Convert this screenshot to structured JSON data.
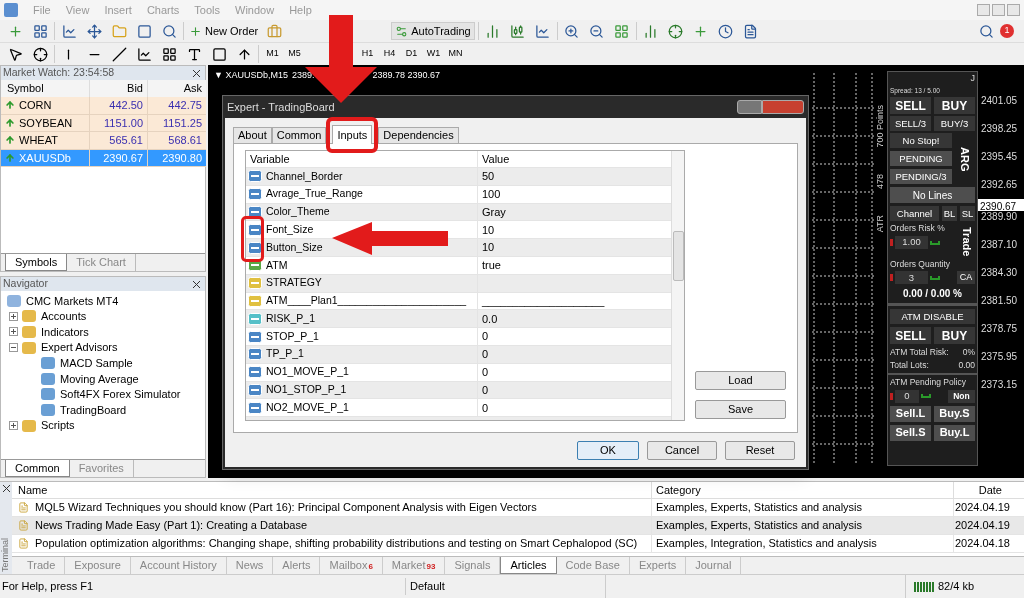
{
  "menu": [
    "File",
    "View",
    "Insert",
    "Charts",
    "Tools",
    "Window",
    "Help"
  ],
  "notifications": "1",
  "toolbar_buttons": [
    "New Order",
    "AutoTrading"
  ],
  "timeframes": [
    {
      "label": "M1",
      "selected": false
    },
    {
      "label": "M5",
      "selected": false
    },
    {
      "label": "H1",
      "selected": false
    },
    {
      "label": "H4",
      "selected": false
    },
    {
      "label": "D1",
      "selected": false
    },
    {
      "label": "W1",
      "selected": false
    },
    {
      "label": "MN",
      "selected": false
    }
  ],
  "market_watch": {
    "title": "Market Watch: 23:54:58",
    "columns": [
      "Symbol",
      "Bid",
      "Ask"
    ],
    "rows": [
      {
        "symbol": "CORN",
        "bid": "442.50",
        "ask": "442.75",
        "selected": false
      },
      {
        "symbol": "SOYBEAN",
        "bid": "1151.00",
        "ask": "1151.25",
        "selected": false
      },
      {
        "symbol": "WHEAT",
        "bid": "565.61",
        "ask": "568.61",
        "selected": false
      },
      {
        "symbol": "XAUUSDb",
        "bid": "2390.67",
        "ask": "2390.80",
        "selected": true
      }
    ],
    "tabs": [
      {
        "label": "Symbols",
        "selected": true
      },
      {
        "label": "Tick Chart",
        "selected": false
      }
    ]
  },
  "navigator": {
    "title": "Navigator",
    "tree": [
      {
        "label": "CMC Markets MT4",
        "children": [
          {
            "label": "Accounts",
            "expanded": false
          },
          {
            "label": "Indicators",
            "expanded": false
          },
          {
            "label": "Expert Advisors",
            "expanded": true,
            "children": [
              {
                "label": "MACD Sample"
              },
              {
                "label": "Moving Average"
              },
              {
                "label": "Soft4FX Forex Simulator"
              },
              {
                "label": "TradingBoard"
              }
            ]
          },
          {
            "label": "Scripts",
            "expanded": false
          }
        ]
      }
    ],
    "tabs": [
      {
        "label": "Common",
        "selected": true
      },
      {
        "label": "Favorites",
        "selected": false
      }
    ]
  },
  "chart": {
    "symbol": "▼ XAUUSDb,M15",
    "header_prices_1": "2389.",
    "header_prices_2": "2389.78 2390.67",
    "prices": [
      {
        "price": "2401.05",
        "current": false
      },
      {
        "price": "2398.25",
        "current": false
      },
      {
        "price": "2395.45",
        "current": false
      },
      {
        "price": "2392.65",
        "current": false
      },
      {
        "price": "2390.67",
        "current": true
      },
      {
        "price": "2389.90",
        "current": false
      },
      {
        "price": "2387.10",
        "current": false
      },
      {
        "price": "2384.30",
        "current": false
      },
      {
        "price": "2381.50",
        "current": false
      },
      {
        "price": "2378.75",
        "current": false
      },
      {
        "price": "2375.95",
        "current": false
      },
      {
        "price": "2373.15",
        "current": false
      }
    ],
    "side_labels": [
      "700 Points",
      "478",
      "ATR"
    ]
  },
  "trading_panel": {
    "corner": "J",
    "spread": "Spread: 13 / 5.00",
    "arg": "ARG",
    "trade": "Trade",
    "sell": "SELL",
    "buy": "BUY",
    "sell3": "SELL/3",
    "buy3": "BUY/3",
    "no_stop": "No Stop!",
    "pending": "PENDING",
    "pending3": "PENDING/3",
    "no_lines": "No Lines",
    "channel": "Channel",
    "bl": "BL",
    "sl": "SL",
    "risk_label": "Orders Risk %",
    "risk_value": "1.00",
    "qty_label": "Orders Quantity",
    "qty_value": "3",
    "ca": "CA",
    "total": "0.00 / 0.00 %",
    "atm_disable": "ATM DISABLE",
    "atm_sell": "SELL",
    "atm_buy": "BUY",
    "atm_risk_label": "ATM Total Risk:",
    "atm_risk_value": "0%",
    "lots_label": "Total Lots:",
    "lots_value": "0.00",
    "policy_label": "ATM Pending Policy",
    "policy_value": "0",
    "policy_mode": "Non",
    "sell_l": "Sell.L",
    "buy_s": "Buy.S",
    "sell_s": "Sell.S",
    "buy_l": "Buy.L"
  },
  "dialog": {
    "title": "Expert - TradingBoard",
    "tabs": [
      {
        "label": "About",
        "selected": false
      },
      {
        "label": "Common",
        "selected": false
      },
      {
        "label": "Inputs",
        "selected": true
      },
      {
        "label": "Dependencies",
        "selected": false
      }
    ],
    "columns": [
      "Variable",
      "Value"
    ],
    "rows": [
      {
        "kind": "int",
        "name": "Channel_Border",
        "value": "50"
      },
      {
        "kind": "int",
        "name": "Avrage_True_Range",
        "value": "100"
      },
      {
        "kind": "int",
        "name": "Color_Theme",
        "value": "Gray"
      },
      {
        "kind": "int",
        "name": "Font_Size",
        "value": "10"
      },
      {
        "kind": "int",
        "name": "Button_Size",
        "value": "10"
      },
      {
        "kind": "bool",
        "name": "ATM",
        "value": "true"
      },
      {
        "kind": "string",
        "name": "STRATEGY"
      },
      {
        "kind": "string",
        "name": "ATM____Plan1______________________",
        "value": "____________________"
      },
      {
        "kind": "double",
        "name": "RISK_P_1",
        "value": "0.0"
      },
      {
        "kind": "int",
        "name": "STOP_P_1",
        "value": "0"
      },
      {
        "kind": "int",
        "name": "TP_P_1",
        "value": "0"
      },
      {
        "kind": "int",
        "name": "NO1_MOVE_P_1",
        "value": "0"
      },
      {
        "kind": "int",
        "name": "NO1_STOP_P_1",
        "value": "0"
      },
      {
        "kind": "int",
        "name": "NO2_MOVE_P_1",
        "value": "0"
      }
    ],
    "side_buttons": [
      "Load",
      "Save"
    ],
    "buttons": [
      {
        "label": "OK",
        "default": true
      },
      {
        "label": "Cancel",
        "default": false
      },
      {
        "label": "Reset",
        "default": false
      }
    ]
  },
  "terminal": {
    "label": "Terminal",
    "columns": [
      "Name",
      "Category",
      "Date"
    ],
    "rows": [
      {
        "name": "MQL5 Wizard Techniques you should know (Part 16): Principal Component Analysis with Eigen Vectors",
        "category": "Examples, Experts, Statistics and analysis",
        "date": "2024.04.19",
        "selected": false
      },
      {
        "name": "News Trading Made Easy (Part 1): Creating a Database",
        "category": "Examples, Experts, Statistics and analysis",
        "date": "2024.04.19",
        "selected": true
      },
      {
        "name": "Population optimization algorithms: Changing shape, shifting probability distributions and testing on Smart Cephalopod (SC)",
        "category": "Examples, Integration, Statistics and analysis",
        "date": "2024.04.18",
        "selected": false
      }
    ],
    "tabs": [
      {
        "label": "Trade",
        "selected": false
      },
      {
        "label": "Exposure",
        "selected": false
      },
      {
        "label": "Account History",
        "selected": false
      },
      {
        "label": "News",
        "selected": false
      },
      {
        "label": "Alerts",
        "selected": false
      },
      {
        "label": "Mailbox",
        "badge": "6",
        "selected": false
      },
      {
        "label": "Market",
        "badge": "93",
        "selected": false
      },
      {
        "label": "Signals",
        "selected": false
      },
      {
        "label": "Articles",
        "selected": true
      },
      {
        "label": "Code Base",
        "selected": false
      },
      {
        "label": "Experts",
        "selected": false
      },
      {
        "label": "Journal",
        "selected": false
      }
    ]
  },
  "status_bar": {
    "help": "For Help, press F1",
    "profile": "Default",
    "traffic": "82/4 kb"
  }
}
